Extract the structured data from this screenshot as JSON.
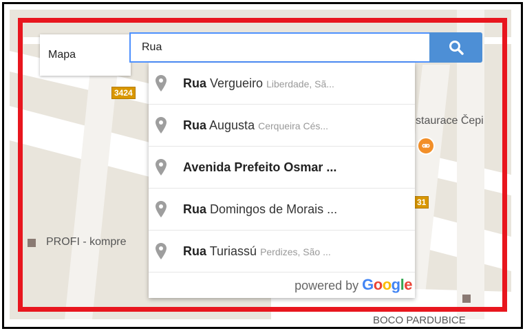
{
  "map_type": {
    "label": "Mapa"
  },
  "search": {
    "value": "Rua",
    "button_icon": "search-icon"
  },
  "suggestions": [
    {
      "match": "Rua",
      "rest": " Vergueiro",
      "secondary": "Liberdade, Sã..."
    },
    {
      "match": "Rua",
      "rest": " Augusta",
      "secondary": "Cerqueira Cés..."
    },
    {
      "match": "",
      "rest": "Avenida Prefeito Osmar ...",
      "secondary": "",
      "bold_all": true
    },
    {
      "match": "Rua",
      "rest": " Domingos de Morais ...",
      "secondary": ""
    },
    {
      "match": "Rua",
      "rest": " Turiassú",
      "secondary": "Perdizes, São ..."
    }
  ],
  "powered_by": {
    "text": "powered by",
    "google": [
      "G",
      "o",
      "o",
      "g",
      "l",
      "e"
    ]
  },
  "map_labels": {
    "road_3424": "3424",
    "road_31": "31",
    "restaurant": "staurace Čepi",
    "profi": "PROFI - kompre",
    "boco": "BOCO PARDUBICE"
  },
  "colors": {
    "frame_red": "#e8161e",
    "search_blue": "#4d8fd6",
    "map_bg": "#e9e5dc",
    "google_blue": "#4285f4",
    "google_red": "#ea4335",
    "google_yellow": "#fbbc05",
    "google_green": "#34a853"
  }
}
